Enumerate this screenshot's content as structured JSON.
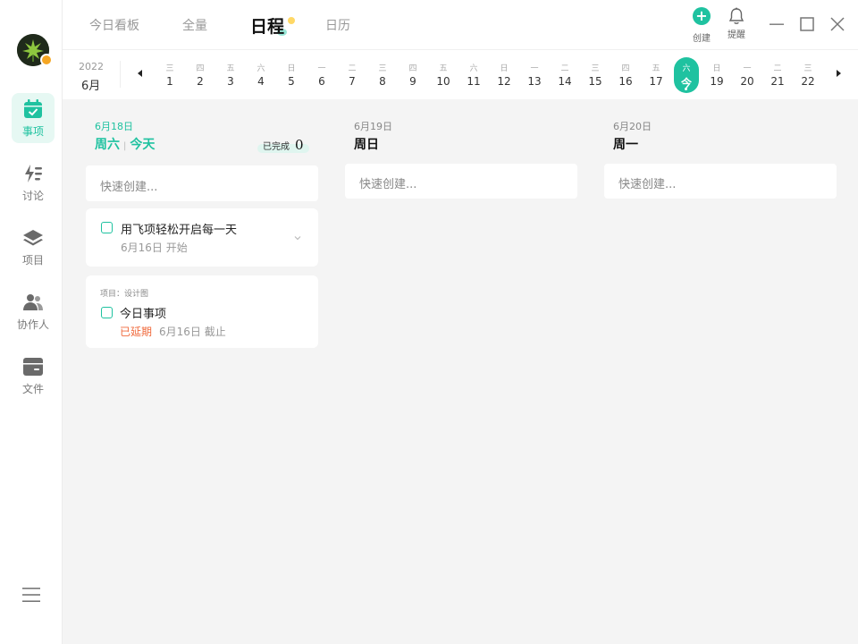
{
  "sidebar": {
    "items": [
      {
        "label": "事项",
        "icon": "calendar-check-icon",
        "active": true
      },
      {
        "label": "讨论",
        "icon": "discussion-icon",
        "active": false
      },
      {
        "label": "项目",
        "icon": "project-layers-icon",
        "active": false
      },
      {
        "label": "协作人",
        "icon": "collaborators-icon",
        "active": false
      },
      {
        "label": "文件",
        "icon": "file-box-icon",
        "active": false
      }
    ]
  },
  "header": {
    "tabs": [
      {
        "label": "今日看板"
      },
      {
        "label": "全量"
      },
      {
        "label": "日程",
        "active": true
      },
      {
        "label": "日历"
      }
    ],
    "create_label": "创建",
    "remind_label": "提醒"
  },
  "datestrip": {
    "year": "2022",
    "month": "6月",
    "days": [
      {
        "wd": "三",
        "dn": "1"
      },
      {
        "wd": "四",
        "dn": "2"
      },
      {
        "wd": "五",
        "dn": "3"
      },
      {
        "wd": "六",
        "dn": "4"
      },
      {
        "wd": "日",
        "dn": "5"
      },
      {
        "wd": "一",
        "dn": "6"
      },
      {
        "wd": "二",
        "dn": "7"
      },
      {
        "wd": "三",
        "dn": "8"
      },
      {
        "wd": "四",
        "dn": "9"
      },
      {
        "wd": "五",
        "dn": "10"
      },
      {
        "wd": "六",
        "dn": "11"
      },
      {
        "wd": "日",
        "dn": "12"
      },
      {
        "wd": "一",
        "dn": "13"
      },
      {
        "wd": "二",
        "dn": "14"
      },
      {
        "wd": "三",
        "dn": "15"
      },
      {
        "wd": "四",
        "dn": "16"
      },
      {
        "wd": "五",
        "dn": "17"
      },
      {
        "wd": "六",
        "dn": "今",
        "today": true
      },
      {
        "wd": "日",
        "dn": "19"
      },
      {
        "wd": "一",
        "dn": "20"
      },
      {
        "wd": "二",
        "dn": "21"
      },
      {
        "wd": "三",
        "dn": "22"
      }
    ]
  },
  "columns": [
    {
      "date": "6月18日",
      "weekday": "周六",
      "today_label": "今天",
      "done_label": "已完成",
      "done_count": "0",
      "quick_placeholder": "快速创建...",
      "tasks": [
        {
          "title": "用飞项轻松开启每一天",
          "meta": "6月16日 开始"
        },
        {
          "project": "项目：设计图",
          "title": "今日事项",
          "status": "已延期",
          "meta": "6月16日 截止"
        }
      ]
    },
    {
      "date": "6月19日",
      "weekday": "周日",
      "quick_placeholder": "快速创建..."
    },
    {
      "date": "6月20日",
      "weekday": "周一",
      "quick_placeholder": "快速创建..."
    }
  ],
  "colors": {
    "accent": "#1fc2a0",
    "overdue": "#f06a3c",
    "background": "#f4f4f4"
  }
}
